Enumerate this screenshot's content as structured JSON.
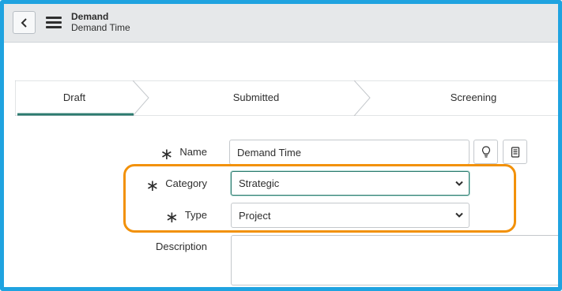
{
  "header": {
    "title": "Demand",
    "subtitle": "Demand Time"
  },
  "flow": {
    "steps": [
      {
        "label": "Draft",
        "active": true
      },
      {
        "label": "Submitted",
        "active": false
      },
      {
        "label": "Screening",
        "active": false
      }
    ]
  },
  "form": {
    "name": {
      "label": "Name",
      "value": "Demand Time",
      "required": true
    },
    "category": {
      "label": "Category",
      "value": "Strategic",
      "required": true
    },
    "type": {
      "label": "Type",
      "value": "Project",
      "required": true
    },
    "description": {
      "label": "Description",
      "value": ""
    }
  },
  "icons": {
    "back": "chevron-left-icon",
    "menu": "hamburger-menu-icon",
    "suggestion": "lightbulb-icon",
    "template": "document-icon",
    "required": "asterisk-icon"
  },
  "colors": {
    "frame_border": "#1fa3e0",
    "highlight": "#f2910a",
    "active_step_underline": "#2c7b6f",
    "header_bg": "#e6e8ea"
  }
}
